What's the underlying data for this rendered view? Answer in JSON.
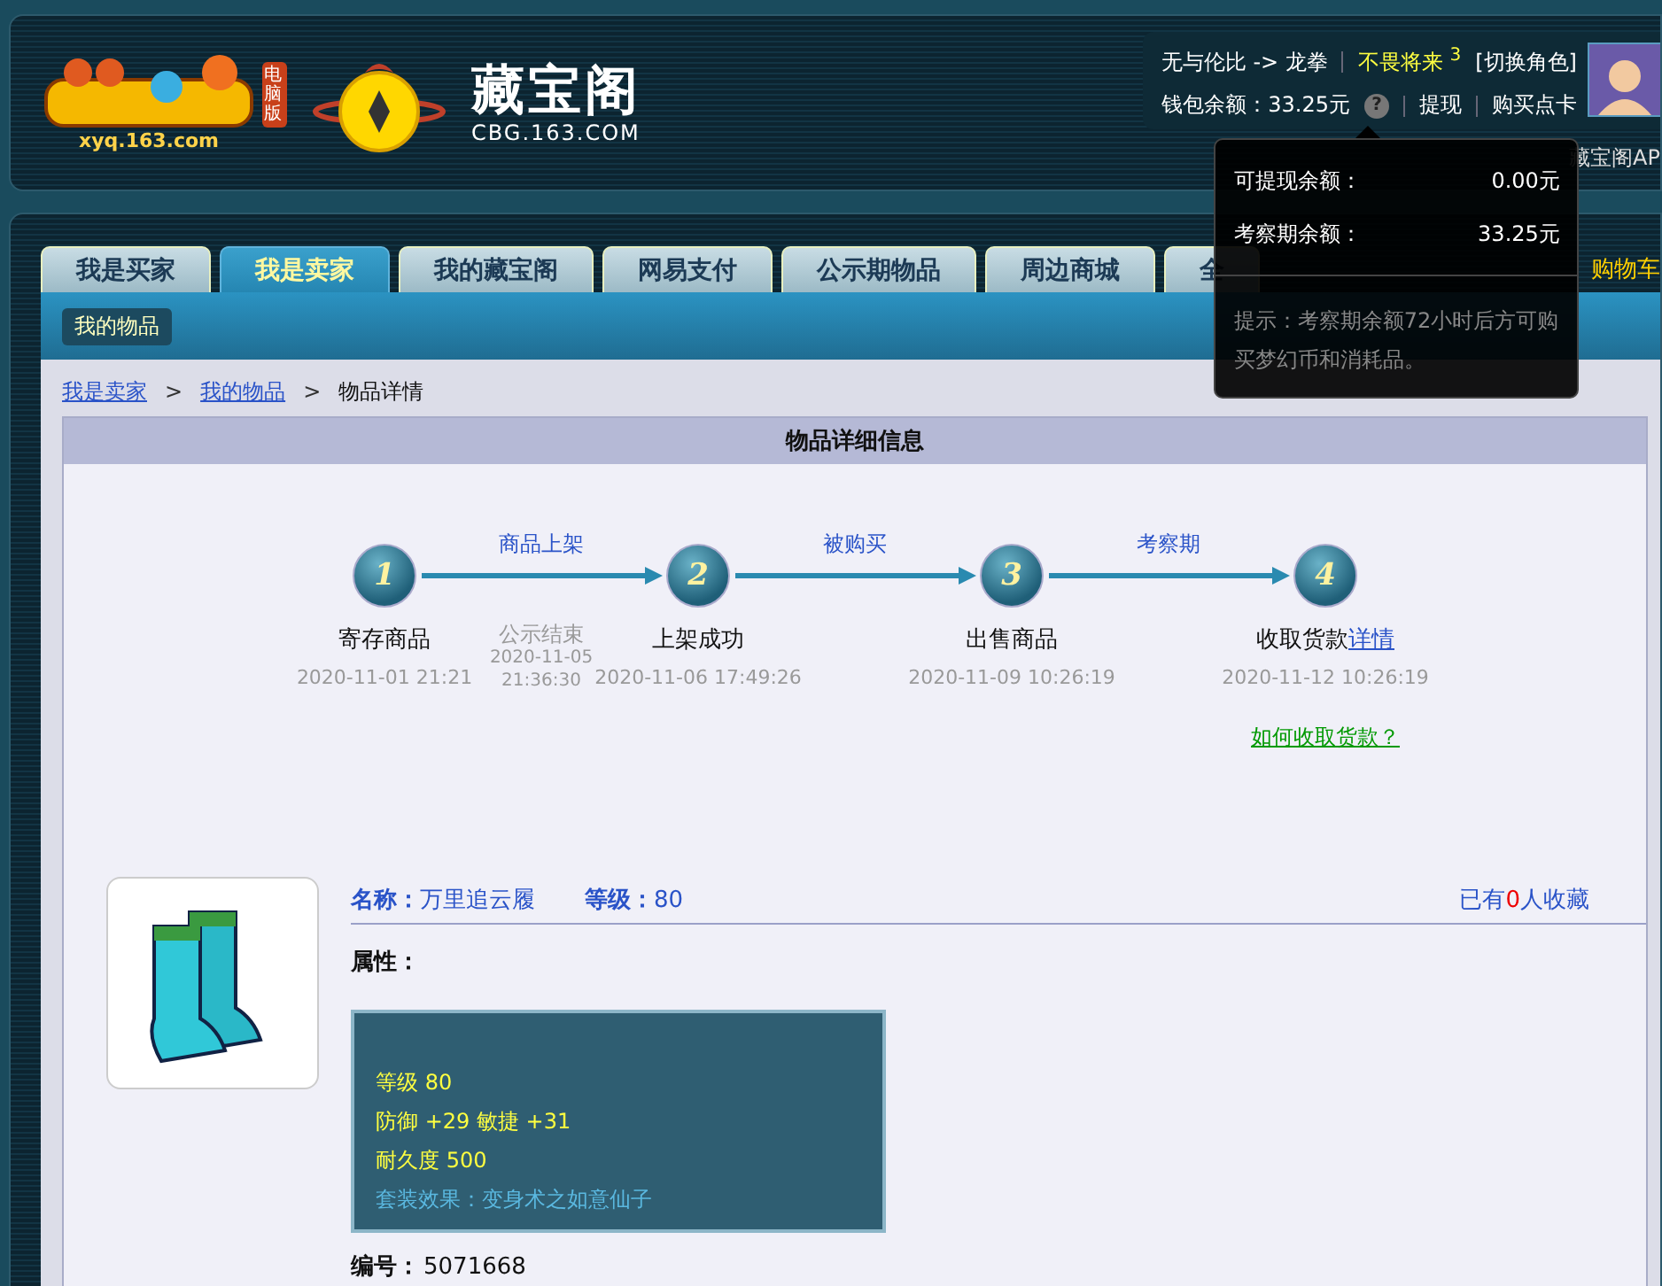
{
  "header": {
    "logo": {
      "domain": "xyq.163.com",
      "badge": "电脑版"
    },
    "brand": {
      "name": "藏宝阁",
      "domain": "CBG.163.COM"
    },
    "user": {
      "account": "无与伦比 -> 龙拳",
      "role": "不畏将来",
      "role_mark": "3",
      "switch": "[切换角色]",
      "wallet_label": "钱包余额：",
      "wallet_value": "33.25元",
      "help": "?",
      "actions": [
        "提现",
        "购买点卡"
      ]
    },
    "links": [
      "藏宝阁AP"
    ],
    "tooltip": {
      "rows": [
        {
          "label": "可提现余额：",
          "value": "0.00元"
        },
        {
          "label": "考察期余额：",
          "value": "33.25元"
        }
      ],
      "hint": "提示：考察期余额72小时后方可购买梦幻币和消耗品。"
    }
  },
  "tabs": [
    {
      "label": "我是买家",
      "selected": false
    },
    {
      "label": "我是卖家",
      "selected": true
    },
    {
      "label": "我的藏宝阁",
      "selected": false
    },
    {
      "label": "网易支付",
      "selected": false
    },
    {
      "label": "公示期物品",
      "selected": false
    },
    {
      "label": "周边商城",
      "selected": false
    },
    {
      "label": "全",
      "selected": false
    }
  ],
  "cart": "购物车",
  "subnav": [
    {
      "label": "我的物品",
      "selected": true
    }
  ],
  "breadcrumb_separator": ">",
  "breadcrumb": [
    {
      "label": "我是卖家",
      "link": true
    },
    {
      "label": "我的物品",
      "link": true
    },
    {
      "label": "物品详情",
      "link": false
    }
  ],
  "panel": {
    "title": "物品详细信息",
    "steps": [
      {
        "number": "1",
        "title": "寄存商品",
        "time": "2020-11-01 21:21"
      },
      {
        "number": "2",
        "title": "上架成功",
        "time": "2020-11-06 17:49:26"
      },
      {
        "number": "3",
        "title": "出售商品",
        "time": "2020-11-09 10:26:19"
      },
      {
        "number": "4",
        "title": "收取货款",
        "link": "详情",
        "time": "2020-11-12 10:26:19"
      }
    ],
    "arrows": [
      {
        "label": "商品上架",
        "note": [
          "公示结束",
          "2020-11-05",
          "21:36:30"
        ]
      },
      {
        "label": "被购买"
      },
      {
        "label": "考察期"
      }
    ],
    "help_link": "如何收取货款？"
  },
  "item": {
    "name_label": "名称：",
    "name": "万里追云履",
    "level_label": "等级：",
    "level": "80",
    "favorites": [
      "已有",
      "0",
      "人收藏"
    ],
    "attributes_label": "属性：",
    "attributes": [
      {
        "kind": "stat",
        "text": "等级 80"
      },
      {
        "kind": "stat",
        "text": "防御 +29 敏捷 +31"
      },
      {
        "kind": "stat",
        "text": "耐久度 500"
      },
      {
        "kind": "set",
        "text": "套装效果：变身术之如意仙子"
      }
    ],
    "id_label": "编号：",
    "id": "5071668"
  }
}
